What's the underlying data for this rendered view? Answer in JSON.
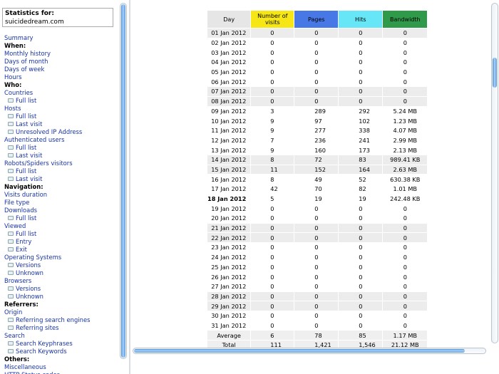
{
  "sidebar": {
    "stats_for_label": "Statistics for:",
    "site_name": "suicidedream.com",
    "items": [
      {
        "label": "Summary",
        "kind": "link"
      },
      {
        "label": "When:",
        "kind": "head"
      },
      {
        "label": "Monthly history",
        "kind": "link"
      },
      {
        "label": "Days of month",
        "kind": "link"
      },
      {
        "label": "Days of week",
        "kind": "link"
      },
      {
        "label": "Hours",
        "kind": "link"
      },
      {
        "label": "Who:",
        "kind": "head"
      },
      {
        "label": "Countries",
        "kind": "link"
      },
      {
        "label": "Full list",
        "kind": "sub"
      },
      {
        "label": "Hosts",
        "kind": "link"
      },
      {
        "label": "Full list",
        "kind": "sub"
      },
      {
        "label": "Last visit",
        "kind": "sub"
      },
      {
        "label": "Unresolved IP Address",
        "kind": "sub"
      },
      {
        "label": "Authenticated users",
        "kind": "link"
      },
      {
        "label": "Full list",
        "kind": "sub"
      },
      {
        "label": "Last visit",
        "kind": "sub"
      },
      {
        "label": "Robots/Spiders visitors",
        "kind": "link"
      },
      {
        "label": "Full list",
        "kind": "sub"
      },
      {
        "label": "Last visit",
        "kind": "sub"
      },
      {
        "label": "Navigation:",
        "kind": "head"
      },
      {
        "label": "Visits duration",
        "kind": "link"
      },
      {
        "label": "File type",
        "kind": "link"
      },
      {
        "label": "Downloads",
        "kind": "link"
      },
      {
        "label": "Full list",
        "kind": "sub"
      },
      {
        "label": "Viewed",
        "kind": "link"
      },
      {
        "label": "Full list",
        "kind": "sub"
      },
      {
        "label": "Entry",
        "kind": "sub"
      },
      {
        "label": "Exit",
        "kind": "sub"
      },
      {
        "label": "Operating Systems",
        "kind": "link"
      },
      {
        "label": "Versions",
        "kind": "sub"
      },
      {
        "label": "Unknown",
        "kind": "sub"
      },
      {
        "label": "Browsers",
        "kind": "link"
      },
      {
        "label": "Versions",
        "kind": "sub"
      },
      {
        "label": "Unknown",
        "kind": "sub"
      },
      {
        "label": "Referrers:",
        "kind": "head"
      },
      {
        "label": "Origin",
        "kind": "link"
      },
      {
        "label": "Referring search engines",
        "kind": "sub"
      },
      {
        "label": "Referring sites",
        "kind": "sub"
      },
      {
        "label": "Search",
        "kind": "link"
      },
      {
        "label": "Search Keyphrases",
        "kind": "sub"
      },
      {
        "label": "Search Keywords",
        "kind": "sub"
      },
      {
        "label": "Others:",
        "kind": "head"
      },
      {
        "label": "Miscellaneous",
        "kind": "link"
      },
      {
        "label": "HTTP Status codes",
        "kind": "link"
      }
    ]
  },
  "table": {
    "headers": {
      "day": "Day",
      "visits_line1": "Number of",
      "visits_line2": "visits",
      "pages": "Pages",
      "hits": "Hits",
      "bandwidth": "Bandwidth"
    },
    "header_colors": {
      "day": "#e6e6e6",
      "visits": "#f6e616",
      "pages": "#4877e6",
      "hits": "#66e6f6",
      "bandwidth": "#2e9a4a"
    },
    "rows": [
      {
        "day": "01 Jan 2012",
        "visits": "0",
        "pages": "0",
        "hits": "0",
        "bandwidth": "0",
        "weekend": true
      },
      {
        "day": "02 Jan 2012",
        "visits": "0",
        "pages": "0",
        "hits": "0",
        "bandwidth": "0",
        "weekend": false
      },
      {
        "day": "03 Jan 2012",
        "visits": "0",
        "pages": "0",
        "hits": "0",
        "bandwidth": "0",
        "weekend": false
      },
      {
        "day": "04 Jan 2012",
        "visits": "0",
        "pages": "0",
        "hits": "0",
        "bandwidth": "0",
        "weekend": false
      },
      {
        "day": "05 Jan 2012",
        "visits": "0",
        "pages": "0",
        "hits": "0",
        "bandwidth": "0",
        "weekend": false
      },
      {
        "day": "06 Jan 2012",
        "visits": "0",
        "pages": "0",
        "hits": "0",
        "bandwidth": "0",
        "weekend": false
      },
      {
        "day": "07 Jan 2012",
        "visits": "0",
        "pages": "0",
        "hits": "0",
        "bandwidth": "0",
        "weekend": true
      },
      {
        "day": "08 Jan 2012",
        "visits": "0",
        "pages": "0",
        "hits": "0",
        "bandwidth": "0",
        "weekend": true
      },
      {
        "day": "09 Jan 2012",
        "visits": "3",
        "pages": "289",
        "hits": "292",
        "bandwidth": "5.24 MB",
        "weekend": false
      },
      {
        "day": "10 Jan 2012",
        "visits": "9",
        "pages": "97",
        "hits": "102",
        "bandwidth": "1.23 MB",
        "weekend": false
      },
      {
        "day": "11 Jan 2012",
        "visits": "9",
        "pages": "277",
        "hits": "338",
        "bandwidth": "4.07 MB",
        "weekend": false
      },
      {
        "day": "12 Jan 2012",
        "visits": "7",
        "pages": "236",
        "hits": "241",
        "bandwidth": "2.99 MB",
        "weekend": false
      },
      {
        "day": "13 Jan 2012",
        "visits": "9",
        "pages": "160",
        "hits": "173",
        "bandwidth": "2.13 MB",
        "weekend": false
      },
      {
        "day": "14 Jan 2012",
        "visits": "8",
        "pages": "72",
        "hits": "83",
        "bandwidth": "989.41 KB",
        "weekend": true
      },
      {
        "day": "15 Jan 2012",
        "visits": "11",
        "pages": "152",
        "hits": "164",
        "bandwidth": "2.63 MB",
        "weekend": true
      },
      {
        "day": "16 Jan 2012",
        "visits": "8",
        "pages": "49",
        "hits": "52",
        "bandwidth": "630.38 KB",
        "weekend": false
      },
      {
        "day": "17 Jan 2012",
        "visits": "42",
        "pages": "70",
        "hits": "82",
        "bandwidth": "1.01 MB",
        "weekend": false
      },
      {
        "day": "18 Jan 2012",
        "visits": "5",
        "pages": "19",
        "hits": "19",
        "bandwidth": "242.48 KB",
        "weekend": false,
        "today": true
      },
      {
        "day": "19 Jan 2012",
        "visits": "0",
        "pages": "0",
        "hits": "0",
        "bandwidth": "0",
        "weekend": false
      },
      {
        "day": "20 Jan 2012",
        "visits": "0",
        "pages": "0",
        "hits": "0",
        "bandwidth": "0",
        "weekend": false
      },
      {
        "day": "21 Jan 2012",
        "visits": "0",
        "pages": "0",
        "hits": "0",
        "bandwidth": "0",
        "weekend": true
      },
      {
        "day": "22 Jan 2012",
        "visits": "0",
        "pages": "0",
        "hits": "0",
        "bandwidth": "0",
        "weekend": true
      },
      {
        "day": "23 Jan 2012",
        "visits": "0",
        "pages": "0",
        "hits": "0",
        "bandwidth": "0",
        "weekend": false
      },
      {
        "day": "24 Jan 2012",
        "visits": "0",
        "pages": "0",
        "hits": "0",
        "bandwidth": "0",
        "weekend": false
      },
      {
        "day": "25 Jan 2012",
        "visits": "0",
        "pages": "0",
        "hits": "0",
        "bandwidth": "0",
        "weekend": false
      },
      {
        "day": "26 Jan 2012",
        "visits": "0",
        "pages": "0",
        "hits": "0",
        "bandwidth": "0",
        "weekend": false
      },
      {
        "day": "27 Jan 2012",
        "visits": "0",
        "pages": "0",
        "hits": "0",
        "bandwidth": "0",
        "weekend": false
      },
      {
        "day": "28 Jan 2012",
        "visits": "0",
        "pages": "0",
        "hits": "0",
        "bandwidth": "0",
        "weekend": true
      },
      {
        "day": "29 Jan 2012",
        "visits": "0",
        "pages": "0",
        "hits": "0",
        "bandwidth": "0",
        "weekend": true
      },
      {
        "day": "30 Jan 2012",
        "visits": "0",
        "pages": "0",
        "hits": "0",
        "bandwidth": "0",
        "weekend": false
      },
      {
        "day": "31 Jan 2012",
        "visits": "0",
        "pages": "0",
        "hits": "0",
        "bandwidth": "0",
        "weekend": false
      }
    ],
    "average": {
      "label": "Average",
      "visits": "6",
      "pages": "78",
      "hits": "85",
      "bandwidth": "1.17 MB"
    },
    "total": {
      "label": "Total",
      "visits": "111",
      "pages": "1,421",
      "hits": "1,546",
      "bandwidth": "21.12 MB"
    }
  }
}
